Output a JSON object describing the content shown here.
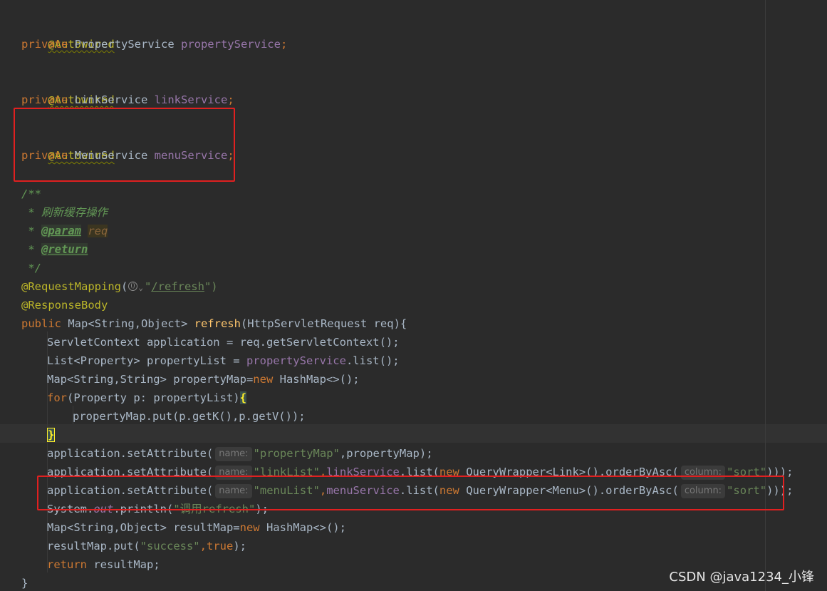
{
  "code": {
    "kw_private": "private",
    "kw_public": "public",
    "kw_new": "new",
    "kw_for": "for",
    "kw_return": "return",
    "kw_true": "true",
    "autowired": "@Autowired",
    "l2_type": "PropertyService ",
    "l2_field": "propertyService",
    "l5_type": "LinkService ",
    "l5_field": "linkService",
    "l8_type": "MenuService ",
    "l8_field": "menuService",
    "semi": ";",
    "doc_open": "/**",
    "doc_text": " * 刷新缓存操作",
    "doc_star": " * ",
    "doc_param_tag": "@param",
    "doc_param_name": "req",
    "doc_return_tag": "@return",
    "doc_close": " */",
    "req_mapping": "@RequestMapping",
    "paren_open": "(",
    "quote_open": "\"",
    "refresh_path": "/refresh",
    "quote_close_paren": "\")",
    "response_body": "@ResponseBody",
    "m_sig_type": " Map<String,Object> ",
    "m_sig_name": "refresh",
    "m_sig_params": "(HttpServletRequest req){",
    "l1": "ServletContext application = req.getServletContext();",
    "l2_pre": "List<Property> propertyList = ",
    "l2_post": ".list();",
    "l3_pre": "Map<String,String> propertyMap=",
    "l3_post": " HashMap<>();",
    "l4_paren": "(Property p: propertyList)",
    "l4_brace": "{",
    "l5": "propertyMap.put(p.getK(),p.getV());",
    "l6_brace": "}",
    "set_attr": "application.setAttribute(",
    "hint_name": "name:",
    "hint_column": "column:",
    "s_property_map": "\"propertyMap\"",
    "l7_post": ",propertyMap);",
    "s_link_list": "\"linkList\"",
    "comma": ",",
    "link_service": "linkService",
    "list_new": ".list(",
    "qw_link": " QueryWrapper<Link>().orderByAsc(",
    "s_sort": "\"sort\"",
    "close3": ")));",
    "s_menu_list": "\"menuList\"",
    "menu_service": "menuService",
    "qw_menu": " QueryWrapper<Menu>().orderByAsc(",
    "sys_pre": "System.",
    "sys_out": "out",
    "sys_post": ".println(",
    "s_refresh": "\"调用refresh\"",
    "close_semi": ");",
    "l11_pre": "Map<String,Object> resultMap=",
    "l11_post": " HashMap<>();",
    "l12_pre": "resultMap.put(",
    "s_success": "\"success\"",
    "l13_post": " resultMap;",
    "close_brace": "}"
  },
  "watermark": "CSDN @java1234_小锋",
  "colors": {
    "background": "#2b2b2b",
    "keyword": "#cc7832",
    "annotation": "#bbb529",
    "field": "#9876aa",
    "string": "#6a8759",
    "method": "#ffc66d",
    "comment": "#629755",
    "highlight_box": "#e02020"
  }
}
